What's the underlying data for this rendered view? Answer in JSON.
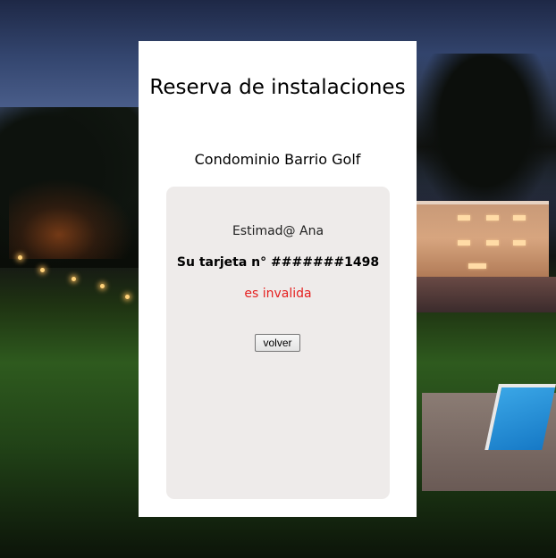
{
  "header": {
    "title": "Reserva de instalaciones",
    "subtitle": "Condominio Barrio Golf"
  },
  "message": {
    "greeting": "Estimad@ Ana",
    "card_number": "Su tarjeta n° #######1498",
    "status": "es invalida",
    "status_color": "#e52020"
  },
  "actions": {
    "back_label": "volver"
  },
  "colors": {
    "card_background": "#ffffff",
    "panel_background": "#eeebea"
  }
}
